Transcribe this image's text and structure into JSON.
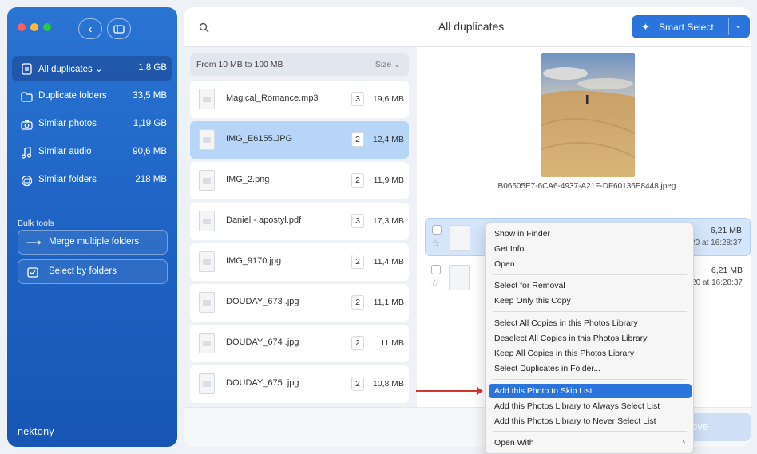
{
  "window": {
    "colors": {
      "sidebar": "#1f64c4",
      "accent": "#2a74dc",
      "selection": "#b7d5f7",
      "highlight_arrow": "#d9352f"
    }
  },
  "sidebar": {
    "items": [
      {
        "label": "All duplicates",
        "chevron": "⌄",
        "size": "1,8 GB",
        "icon": "document-icon",
        "active": true
      },
      {
        "label": "Duplicate folders",
        "size": "33,5 MB",
        "icon": "folder-icon"
      },
      {
        "label": "Similar photos",
        "size": "1,19 GB",
        "icon": "camera-icon"
      },
      {
        "label": "Similar audio",
        "size": "90,6 MB",
        "icon": "music-note-icon"
      },
      {
        "label": "Similar folders",
        "size": "218 MB",
        "icon": "folder-stack-icon"
      }
    ],
    "bulk_tools_label": "Bulk tools",
    "bulk_buttons": [
      {
        "label": "Merge multiple folders",
        "icon": "merge-arrow-icon"
      },
      {
        "label": "Select by folders",
        "icon": "folder-check-icon"
      }
    ],
    "brand": "nektony"
  },
  "header": {
    "title": "All duplicates",
    "smart_select_label": "Smart Select",
    "search_icon": "search-icon"
  },
  "file_list": {
    "range_label": "From 10 MB to 100 MB",
    "sort_label": "Size ⌄",
    "rows": [
      {
        "name": "Magical_Romance.mp3",
        "count": "3",
        "size": "19,6 MB"
      },
      {
        "name": "IMG_E6155.JPG",
        "count": "2",
        "size": "12,4 MB",
        "selected": true
      },
      {
        "name": "IMG_2.png",
        "count": "2",
        "size": "11,9 MB"
      },
      {
        "name": "Daniel - apostyl.pdf",
        "count": "3",
        "size": "17,3 MB"
      },
      {
        "name": "IMG_9170.jpg",
        "count": "2",
        "size": "11,4 MB"
      },
      {
        "name": "DOUDAY_673 .jpg",
        "count": "2",
        "size": "11,1 MB"
      },
      {
        "name": "DOUDAY_674 .jpg",
        "count": "2",
        "size": "11 MB"
      },
      {
        "name": "DOUDAY_675 .jpg",
        "count": "2",
        "size": "10,8 MB"
      }
    ]
  },
  "preview": {
    "caption": "B06605E7-6CA6-4937-A21F-DF60136E8448.jpeg"
  },
  "duplicates": [
    {
      "size": "6,21 MB",
      "date": "20 at 16:28:37",
      "selected": true
    },
    {
      "size": "6,21 MB",
      "date": "20 at 16:28:37"
    }
  ],
  "remove_button_label": "ove",
  "context_menu": {
    "items": [
      "Show in Finder",
      "Get Info",
      "Open",
      "Select for Removal",
      "Keep Only this Copy",
      "Select All Copies in this Photos Library",
      "Deselect All Copies in this Photos Library",
      "Keep All Copies in this Photos Library",
      "Select Duplicates in Folder...",
      "Add this Photo to Skip List",
      "Add this Photos Library to Always Select List",
      "Add this Photos Library to Never Select List",
      "Open With"
    ],
    "highlighted": "Add this Photo to Skip List",
    "submenu_arrow": "›"
  }
}
